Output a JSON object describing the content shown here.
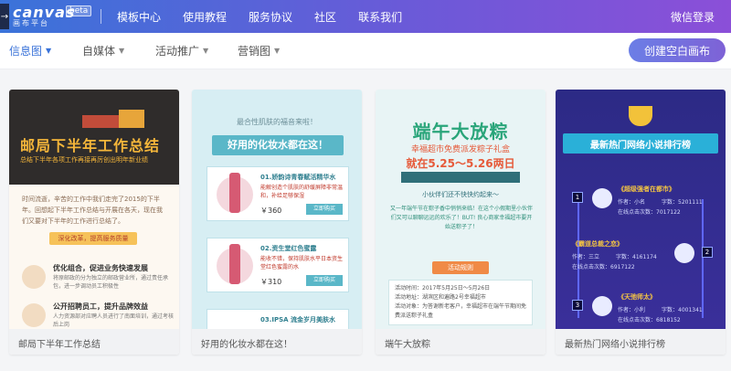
{
  "header": {
    "logo_text": "canvas",
    "logo_sub": "画布平台",
    "beta": "beta",
    "nav": [
      "模板中心",
      "使用教程",
      "服务协议",
      "社区",
      "联系我们"
    ],
    "login": "微信登录"
  },
  "filters": [
    {
      "label": "信息图",
      "active": true
    },
    {
      "label": "自媒体",
      "active": false
    },
    {
      "label": "活动推广",
      "active": false
    },
    {
      "label": "营销图",
      "active": false
    }
  ],
  "create_button": "创建空白画布",
  "cards": [
    {
      "caption": "邮局下半年工作总结",
      "preview": {
        "title": "邮局下半年工作总结",
        "sub": "总结下半年各项工作再接再厉创出明年新业绩",
        "para": "时间流逝，辛苦的工作中我们走完了2015的下半年。回想起下半年工作总结与开展在各天，现在我们又要对下半年的工作进行总结了。",
        "pill": "深化改革，提高服务质量",
        "items": [
          {
            "t": "优化组合，促进业务快速发展",
            "d": "将原邮政的分为独立的邮政营业所，通过责任承包，进一步调动员工积极性"
          },
          {
            "t": "公开招聘员工，提升品牌效益",
            "d": "人力资源部对应聘人员进行了南面培训，通过考核后上岗"
          }
        ]
      }
    },
    {
      "caption": "好用的化妆水都在这！",
      "preview": {
        "kicker": "最合性肌肤的福音来啦！",
        "banner": "好用的化妆水都在这！",
        "products": [
          {
            "t": "01.娇韵诗青春赋活精华水",
            "d": "能解创造个肌肤的舒缓屏障非常温和，补给足够保湿",
            "price": "￥360",
            "buy": "立即购买"
          },
          {
            "t": "02.资生堂红色蜜露",
            "d": "能收不错，保持肌肤水平日本资生堂红色蜜露的水",
            "price": "￥310",
            "buy": "立即购买"
          },
          {
            "t": "03.IPSA 流金岁月美肤水",
            "d": "",
            "price": "",
            "buy": ""
          }
        ]
      }
    },
    {
      "caption": "端午大放粽",
      "preview": {
        "title": "端午大放粽",
        "sub": "幸福超市免费派发粽子礼盒",
        "date": "就在5.25～5.26两日",
        "invite": "小伙伴们还不快快约起来～",
        "para": "又一年端午节在粽子香中悄悄来临！在这个小假期里小伙伴们又可以聊聊远远的欢乐了！BUT! 良心商家幸福超市要开始送粽子了！",
        "rule_title": "活动规则",
        "rules": [
          "活动时间：2017年5月25日～5月26日",
          "活动地址：湖滨区和遍路2号幸福超市",
          "活动对象：为答谢新老客户，幸福超市在端午节期间免费派送粽子礼盒"
        ]
      }
    },
    {
      "caption": "最新热门网络小说排行榜",
      "preview": {
        "title": "最新热门网络小说排行榜",
        "ranks": [
          {
            "n": "1",
            "book": "《超级强者在都市》",
            "author": "作者：小名",
            "words": "字数：5201111",
            "clicks": "在线点击次数：7017122"
          },
          {
            "n": "2",
            "book": "《霸道总裁之恋》",
            "author": "作者：三立",
            "words": "字数：4161174",
            "clicks": "在线点击次数：6917122"
          },
          {
            "n": "3",
            "book": "《天弛师太》",
            "author": "作者：小利",
            "words": "字数：4001341",
            "clicks": "在线点击次数：6818152"
          }
        ]
      }
    }
  ]
}
